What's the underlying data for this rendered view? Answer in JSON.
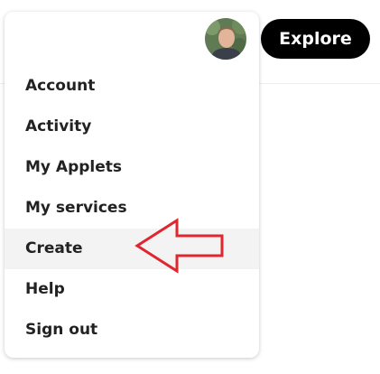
{
  "header": {
    "explore_label": "Explore"
  },
  "menu": {
    "items": [
      {
        "label": "Account"
      },
      {
        "label": "Activity"
      },
      {
        "label": "My Applets"
      },
      {
        "label": "My services"
      },
      {
        "label": "Create",
        "highlighted": true
      },
      {
        "label": "Help"
      },
      {
        "label": "Sign out"
      }
    ]
  },
  "annotation": {
    "arrow_color": "#e0262e",
    "arrow_points_to": "Create"
  },
  "colors": {
    "explore_bg": "#000000",
    "highlight_bg": "#f3f3f3",
    "text": "#222222"
  }
}
